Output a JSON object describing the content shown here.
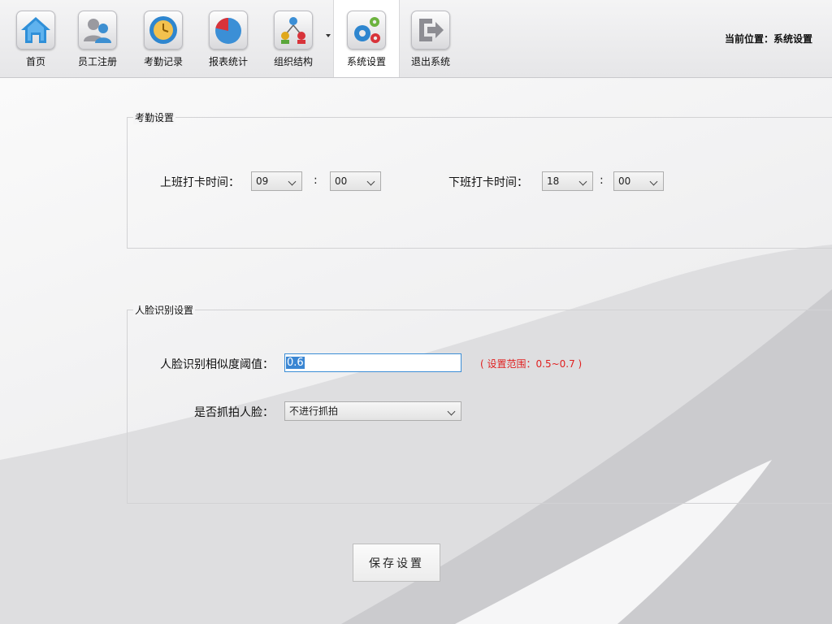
{
  "toolbar": {
    "items": [
      {
        "label": "首页",
        "icon": "home-icon"
      },
      {
        "label": "员工注册",
        "icon": "users-icon"
      },
      {
        "label": "考勤记录",
        "icon": "clock-icon"
      },
      {
        "label": "报表统计",
        "icon": "pie-chart-icon"
      },
      {
        "label": "组织结构",
        "icon": "org-chart-icon"
      },
      {
        "label": "系统设置",
        "icon": "gears-icon",
        "active": true
      },
      {
        "label": "退出系统",
        "icon": "exit-icon"
      }
    ]
  },
  "location": {
    "label": "当前位置：",
    "value": "系统设置"
  },
  "attendance": {
    "title": "考勤设置",
    "start_label": "上班打卡时间：",
    "start_hour": "09",
    "start_minute": "00",
    "end_label": "下班打卡时间：",
    "end_hour": "18",
    "end_minute": "00",
    "separator": ":"
  },
  "face": {
    "title": "人脸识别设置",
    "threshold_label": "人脸识别相似度阈值：",
    "threshold_value": "0.6",
    "range_hint": "( 设置范围：0.5~0.7 )",
    "capture_label": "是否抓拍人脸：",
    "capture_value": "不进行抓拍"
  },
  "save_label": "保存设置",
  "colors": {
    "accent": "#3a86d3",
    "hint": "#e02020"
  }
}
